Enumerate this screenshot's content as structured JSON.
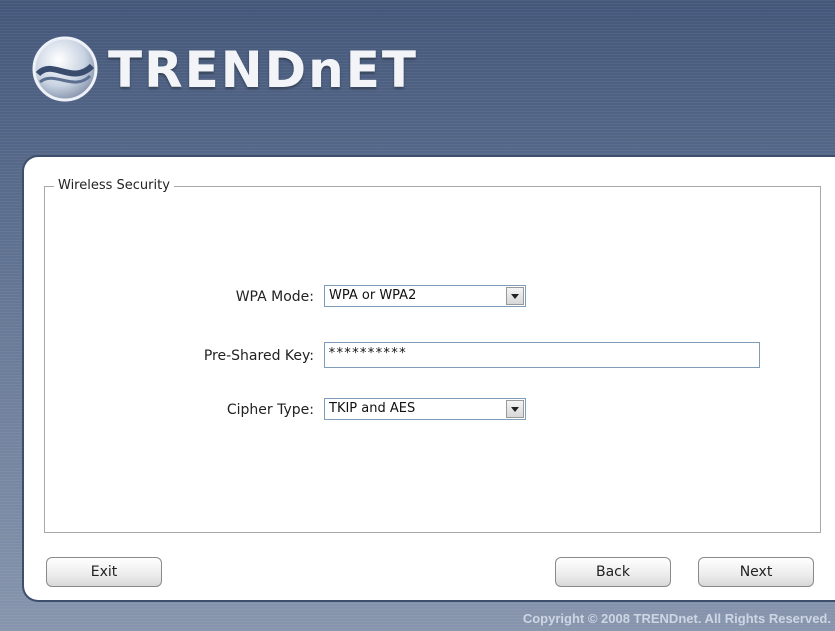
{
  "brand": {
    "name": "TRENDnET"
  },
  "section": {
    "title": "Wireless Security"
  },
  "form": {
    "wpa_mode": {
      "label": "WPA Mode:",
      "value": "WPA or WPA2"
    },
    "psk": {
      "label": "Pre-Shared Key:",
      "value": "**********"
    },
    "cipher": {
      "label": "Cipher Type:",
      "value": "TKIP and AES"
    }
  },
  "buttons": {
    "exit": "Exit",
    "back": "Back",
    "next": "Next"
  },
  "footer": {
    "copyright": "Copyright © 2008 TRENDnet. All Rights Reserved."
  },
  "colors": {
    "frame": "#5b6d86",
    "panel_border": "#3e4f6e",
    "field_border": "#7f9db9"
  }
}
